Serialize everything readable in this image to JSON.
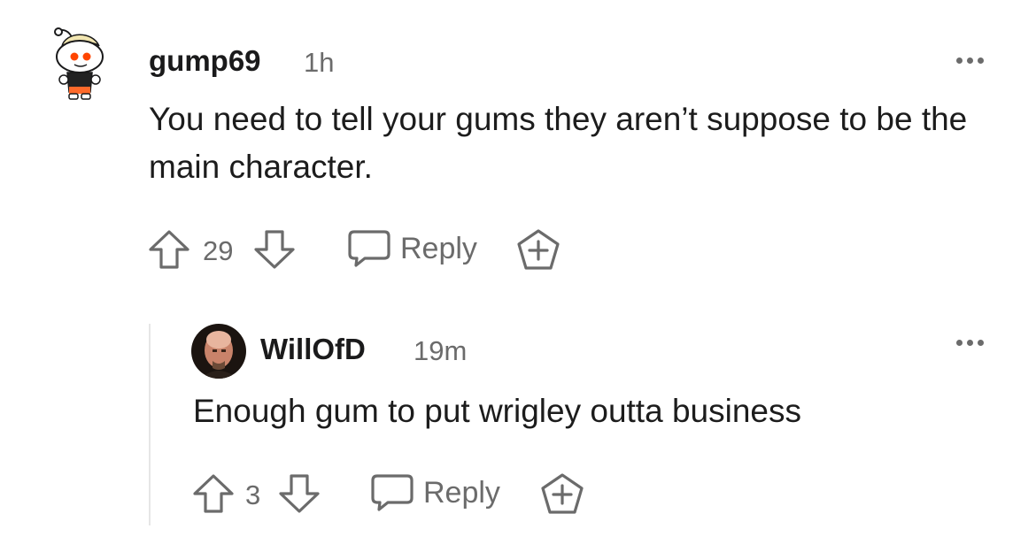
{
  "comments": [
    {
      "username": "gump69",
      "time": "1h",
      "text": "You need to tell your gums they aren’t suppose to be the main character.",
      "votes": "29",
      "reply_label": "Reply",
      "avatar_icon": "snoo-avatar-icon"
    },
    {
      "username": "WillOfD",
      "time": "19m",
      "text": "Enough gum to put wrigley outta business",
      "votes": "3",
      "reply_label": "Reply",
      "avatar_icon": "photo-avatar"
    }
  ],
  "colors": {
    "text": "#1a1a1b",
    "muted": "#6b6b6b",
    "thread_line": "#e6e6e6",
    "snoo_orange": "#ff4500",
    "snoo_hair": "#f2e6b1"
  }
}
